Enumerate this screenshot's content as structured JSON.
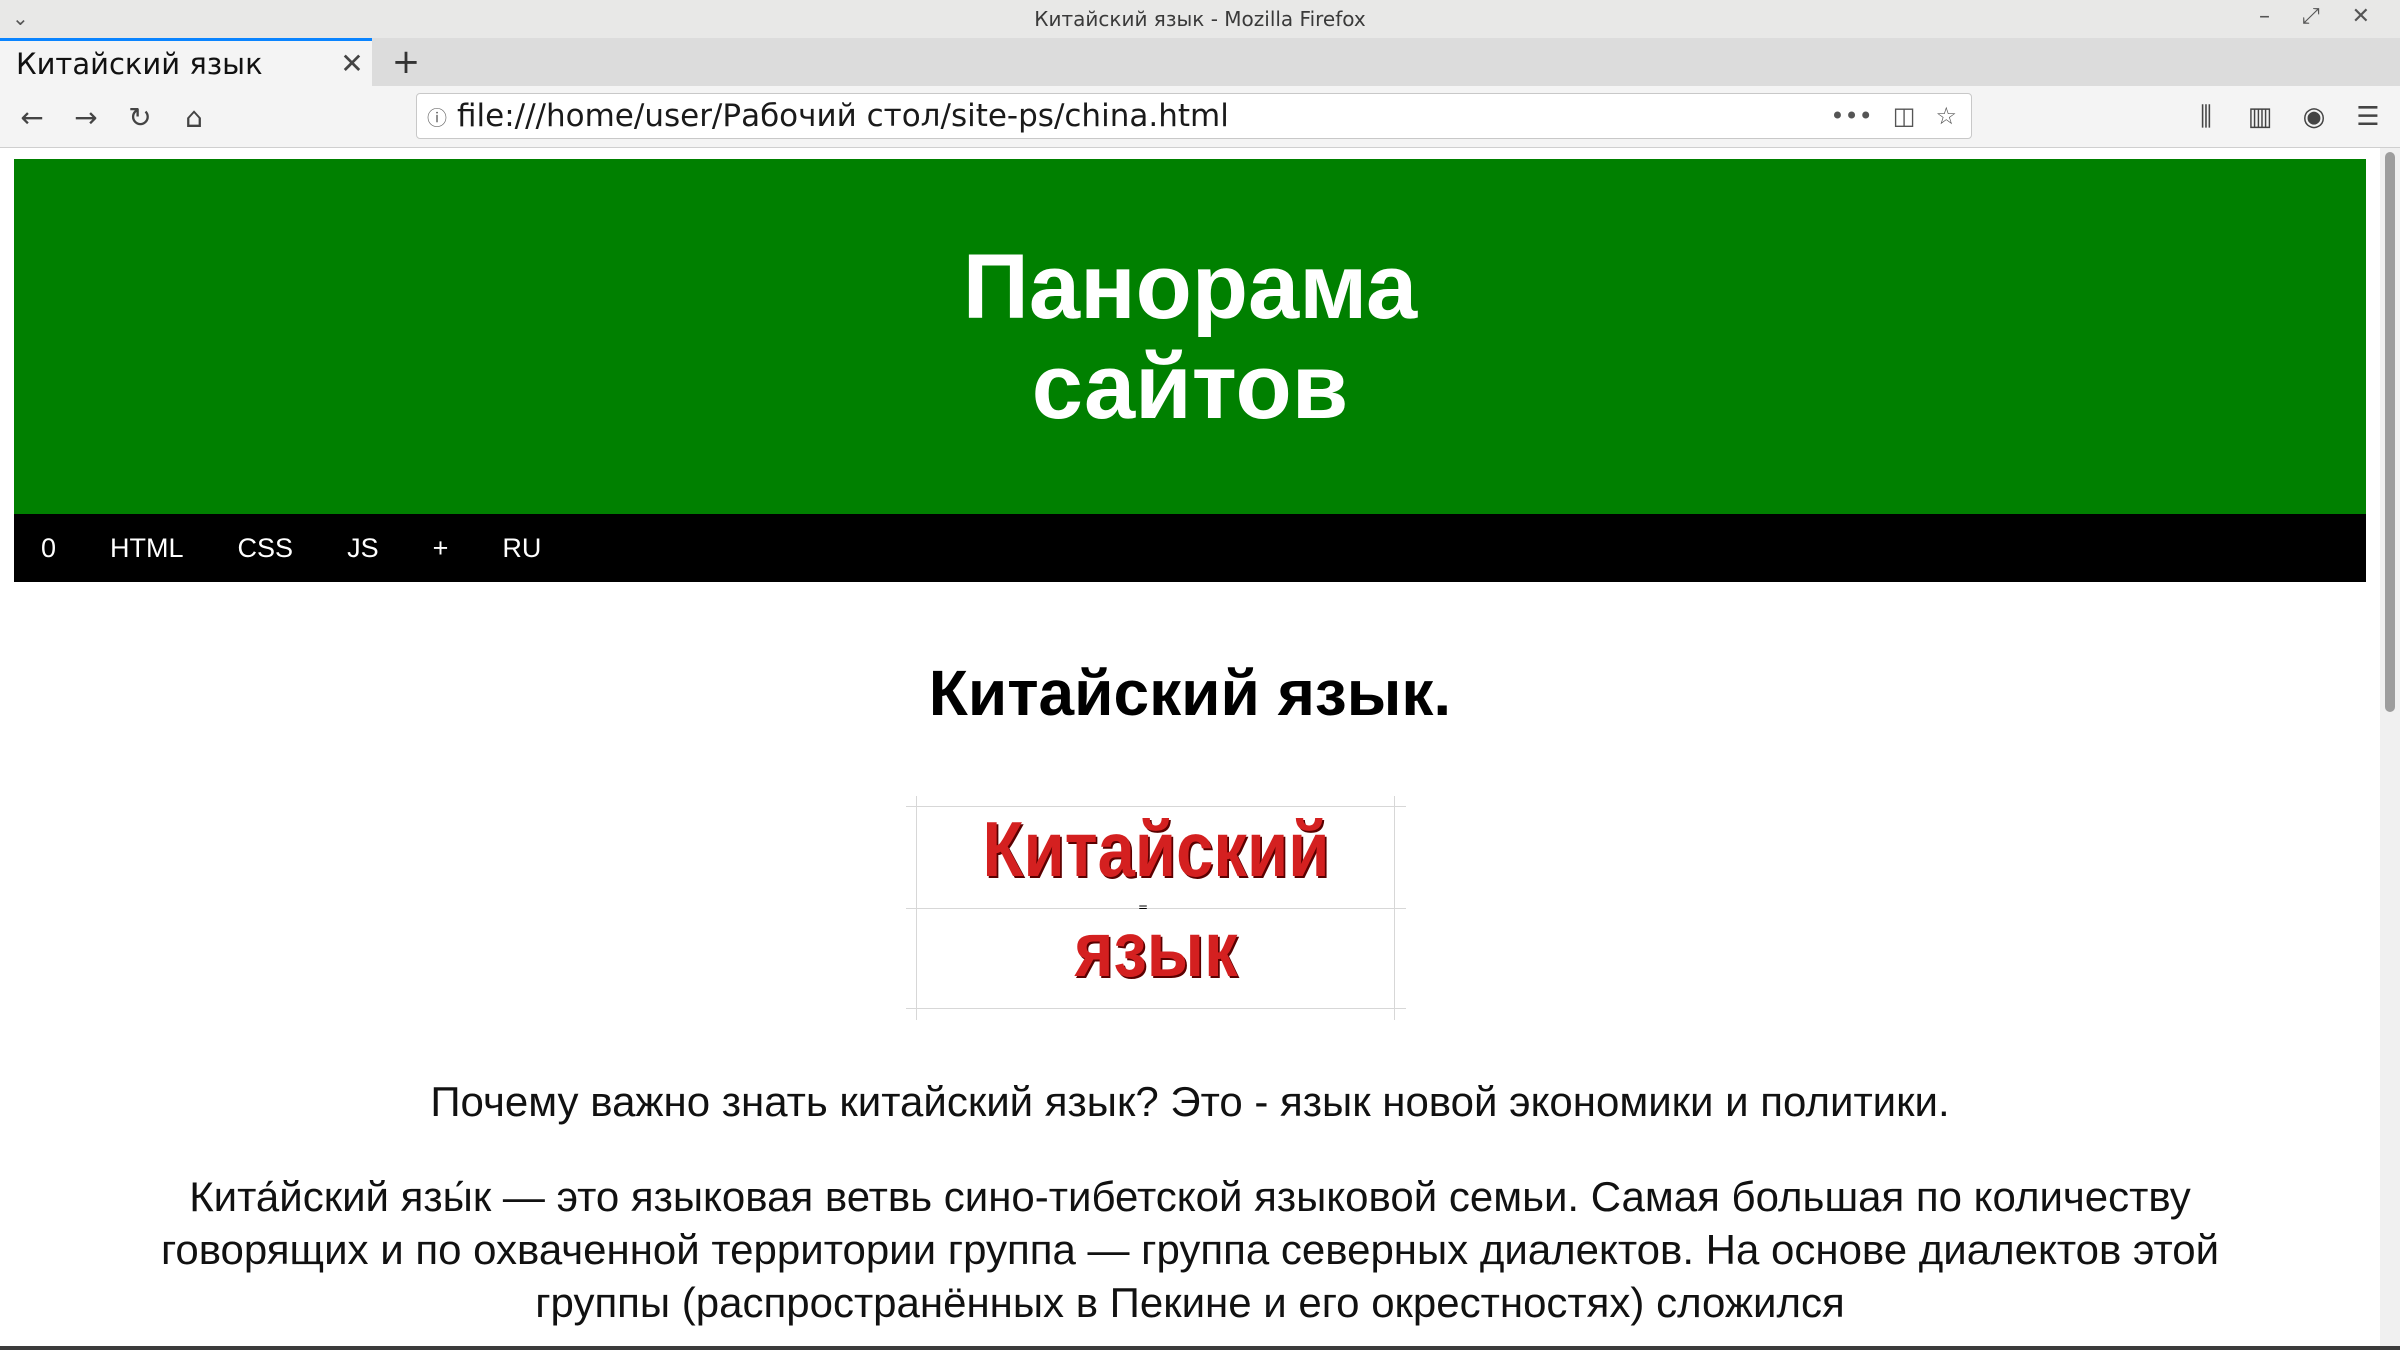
{
  "window": {
    "title": "Китайский язык - Mozilla Firefox"
  },
  "tab": {
    "title": "Китайский язык"
  },
  "toolbar": {
    "url": "file:///home/user/Рабочий стол/site-ps/china.html"
  },
  "site": {
    "title_line1": "Панорама",
    "title_line2": "сайтов",
    "nav": [
      "0",
      "HTML",
      "CSS",
      "JS",
      "+",
      "RU"
    ]
  },
  "page": {
    "heading": "Китайский язык.",
    "banner_line1": "Китайский",
    "banner_line2": "язык",
    "banner_mark": "=",
    "lead": "Почему важно знать китайский язык? Это - язык новой экономики и политики.",
    "body": "Кита́йский язы́к — это языковая ветвь сино-тибетской языковой семьи. Самая большая по количеству говорящих и по охваченной территории группа — группа северных диалектов. На основе диалектов этой группы (распространённых в Пекине и его окрестностях) сложился"
  },
  "colors": {
    "header_bg": "#008000",
    "nav_bg": "#000000",
    "banner_text": "#d42020",
    "tab_accent": "#0a84ff"
  },
  "icons": {
    "back": "arrow-left-icon",
    "forward": "arrow-right-icon",
    "reload": "reload-icon",
    "home": "home-icon",
    "site_info": "info-icon",
    "page_actions": "more-icon",
    "pocket": "pocket-icon",
    "bookmark": "star-icon",
    "library": "library-icon",
    "sidebar": "sidebar-icon",
    "account": "account-icon",
    "menu": "hamburger-menu-icon"
  }
}
